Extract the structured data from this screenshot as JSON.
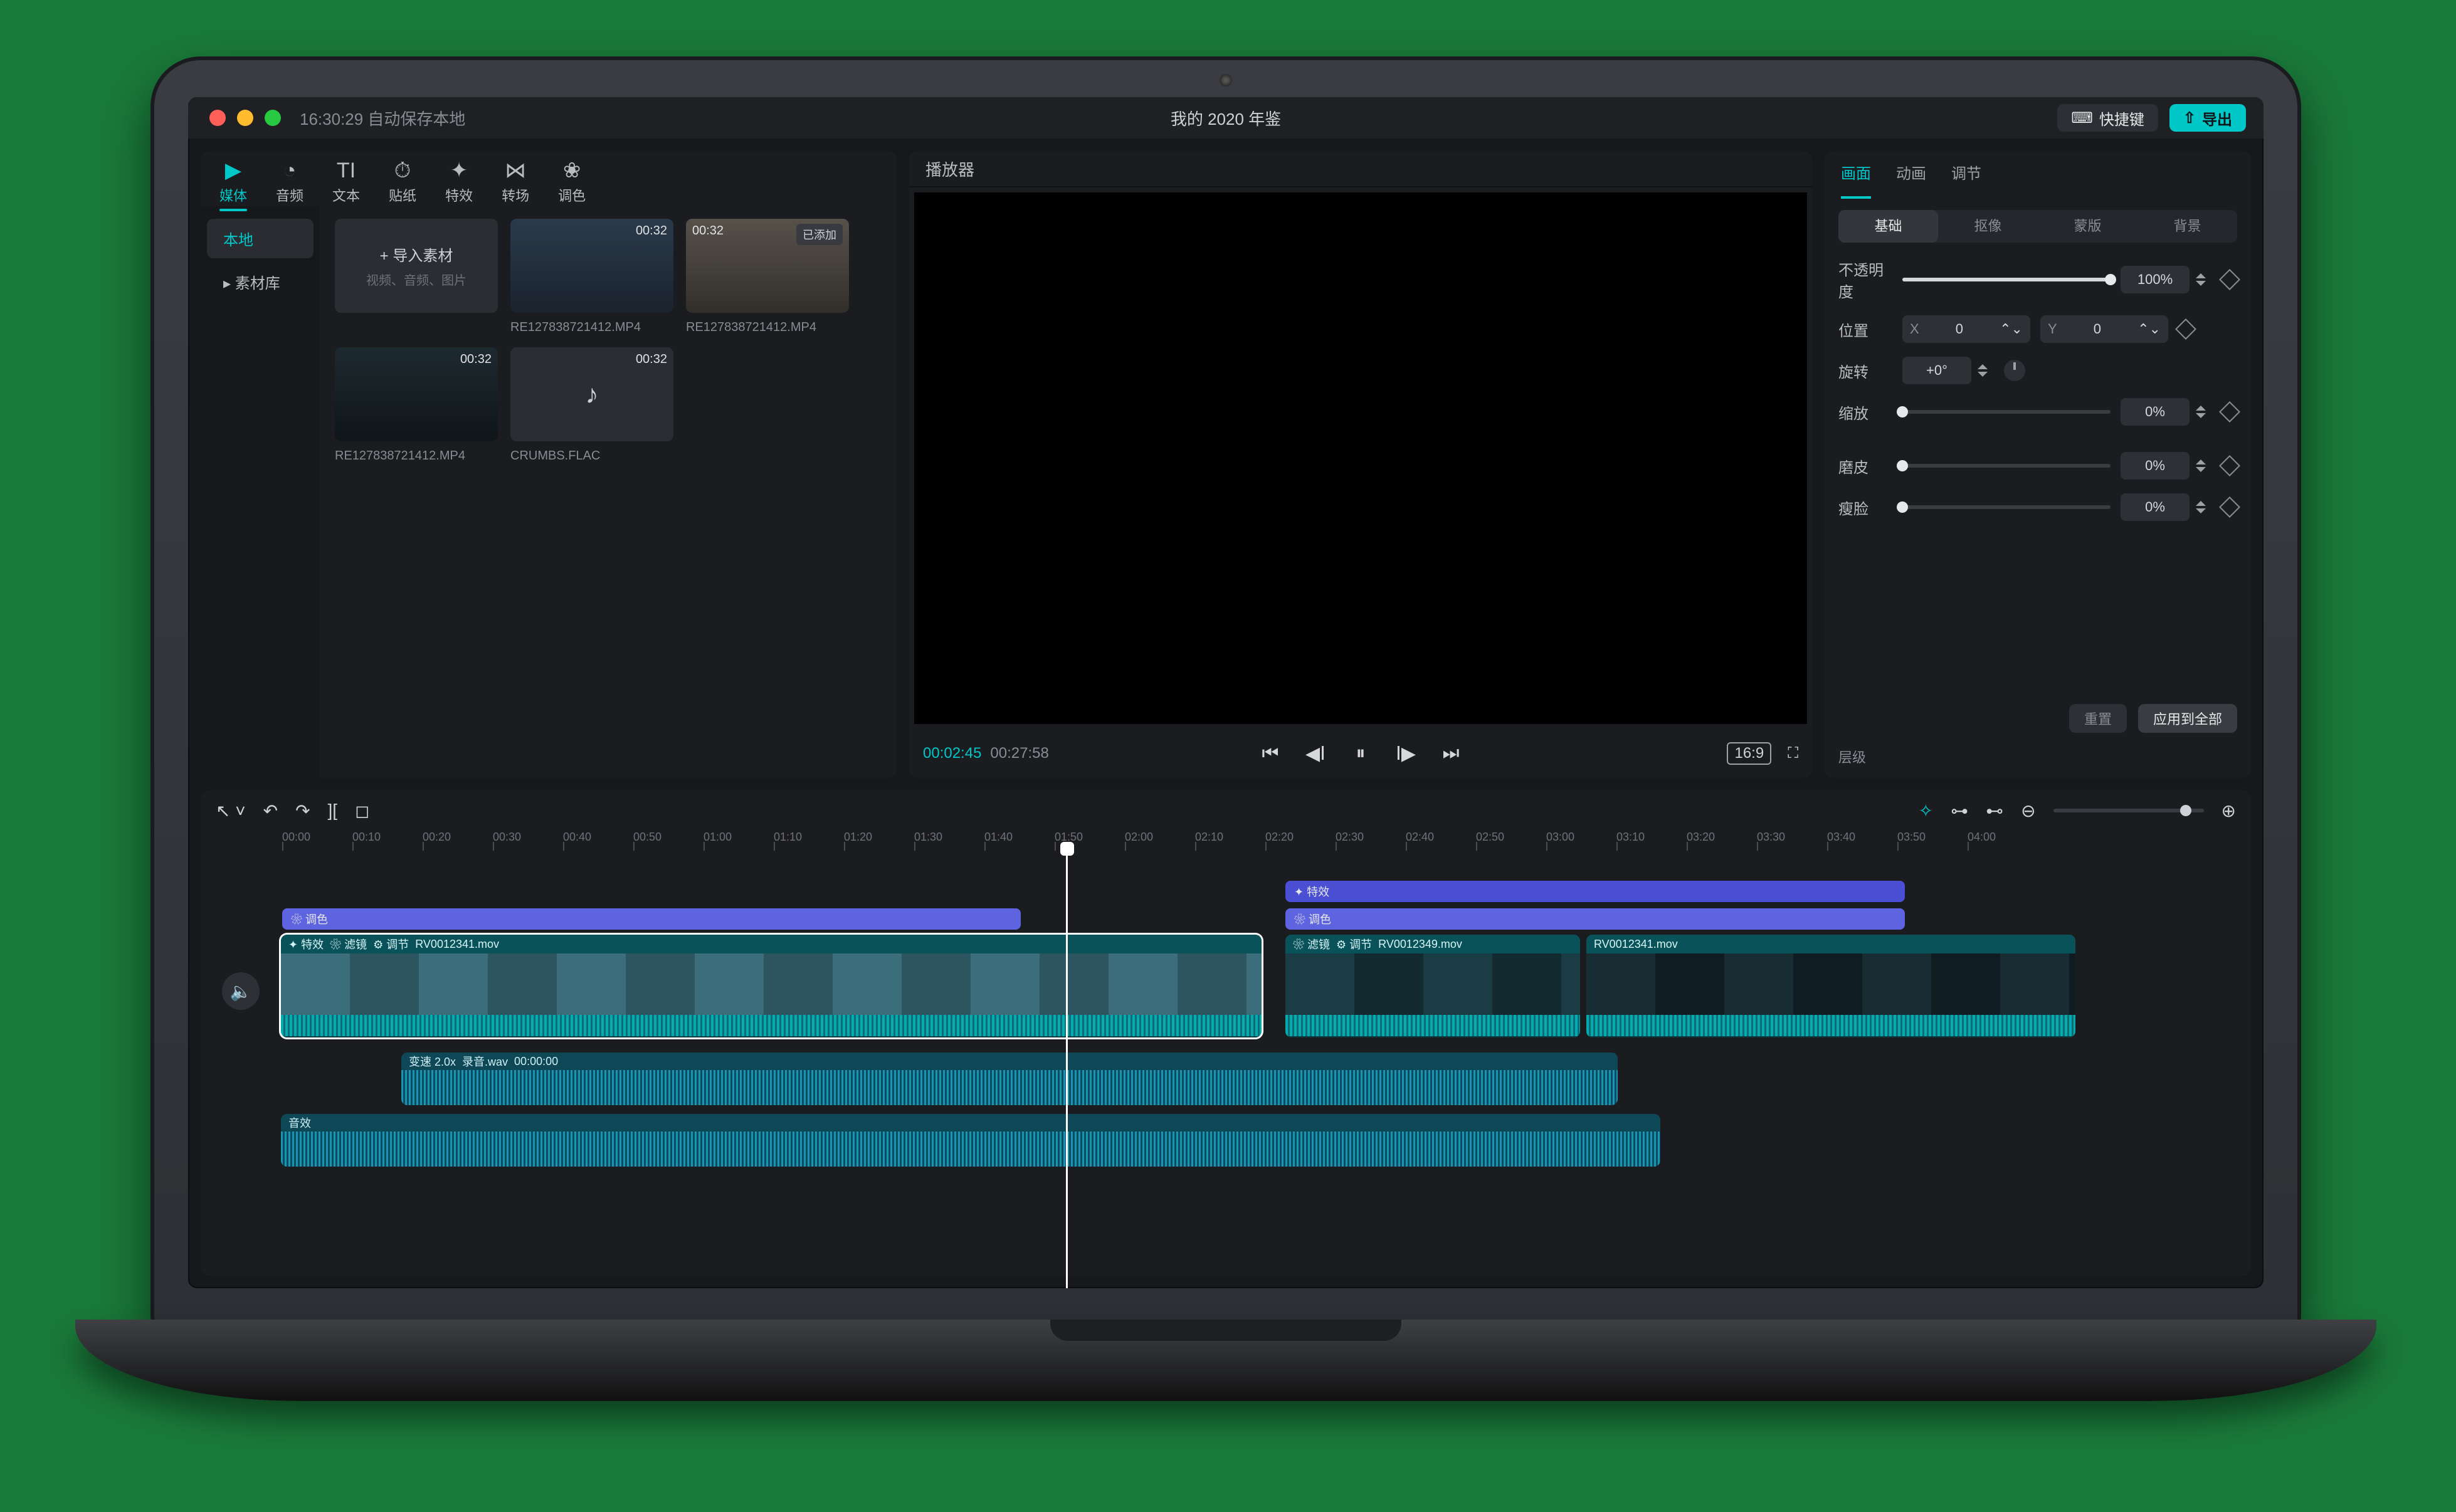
{
  "titlebar": {
    "autosave": "16:30:29 自动保存本地",
    "project_title": "我的 2020 年鉴",
    "shortcut_label": "快捷键",
    "export_label": "导出"
  },
  "media": {
    "tabs": [
      {
        "id": "media",
        "icon": "▶",
        "label": "媒体"
      },
      {
        "id": "audio",
        "icon": "◔",
        "label": "音频"
      },
      {
        "id": "text",
        "icon": "TI",
        "label": "文本"
      },
      {
        "id": "sticker",
        "icon": "⏱",
        "label": "贴纸"
      },
      {
        "id": "effects",
        "icon": "✦",
        "label": "特效"
      },
      {
        "id": "trans",
        "icon": "⋈",
        "label": "转场"
      },
      {
        "id": "color",
        "icon": "❀",
        "label": "调色"
      }
    ],
    "side": [
      {
        "label": "本地",
        "active": true
      },
      {
        "label": "▸ 素材库",
        "active": false
      }
    ],
    "import": {
      "title": "+ 导入素材",
      "subtitle": "视频、音频、图片"
    },
    "items": [
      {
        "name": "RE127838721412.MP4",
        "duration": "00:32",
        "tag": "",
        "cls": "m1"
      },
      {
        "name": "RE127838721412.MP4",
        "duration": "00:32",
        "tag": "已添加",
        "cls": "m2"
      },
      {
        "name": "RE127838721412.MP4",
        "duration": "00:32",
        "tag": "",
        "cls": "m3"
      },
      {
        "name": "CRUMBS.FLAC",
        "duration": "00:32",
        "tag": "",
        "cls": "audio"
      }
    ]
  },
  "player": {
    "title": "播放器",
    "current_tc": "00:02:45",
    "duration_tc": "00:27:58",
    "aspect": "16:9"
  },
  "inspector": {
    "tabs": [
      "画面",
      "动画",
      "调节"
    ],
    "subtabs": [
      "基础",
      "抠像",
      "蒙版",
      "背景"
    ],
    "opacity": {
      "label": "不透明度",
      "value": "100%",
      "pct": 100
    },
    "position": {
      "label": "位置",
      "x": "0",
      "y": "0"
    },
    "rotation": {
      "label": "旋转",
      "value": "+0°"
    },
    "scale": {
      "label": "缩放",
      "value": "0%",
      "pct": 0
    },
    "smooth": {
      "label": "磨皮",
      "value": "0%",
      "pct": 0
    },
    "slim": {
      "label": "瘦脸",
      "value": "0%",
      "pct": 0
    },
    "reset": "重置",
    "apply_all": "应用到全部",
    "layer_label": "层级"
  },
  "timeline": {
    "ruler": [
      "00:00",
      "00:10",
      "00:20",
      "00:30",
      "00:40",
      "00:50",
      "01:00",
      "01:10",
      "01:20",
      "01:30",
      "01:40",
      "01:50",
      "02:00",
      "02:10",
      "02:20",
      "02:30",
      "02:40",
      "02:50",
      "03:00",
      "03:10",
      "03:20",
      "03:30",
      "03:40",
      "03:50",
      "04:00"
    ],
    "fx1": {
      "label": "✦ 特效"
    },
    "grade1": {
      "label": "❀ 调色"
    },
    "grade2": {
      "label": "❀ 调色"
    },
    "clip1": {
      "tags": [
        "✦ 特效",
        "❀ 滤镜",
        "⚙ 调节"
      ],
      "name": "RV0012341.mov"
    },
    "clip2": {
      "tags": [
        "❀ 滤镜",
        "⚙ 调节"
      ],
      "name": "RV0012349.mov"
    },
    "clip3": {
      "name": "RV0012341.mov"
    },
    "audio1": {
      "speed": "变速 2.0x",
      "name": "录音.wav",
      "tc": "00:00:00"
    },
    "audio2": {
      "label": "音效"
    }
  }
}
